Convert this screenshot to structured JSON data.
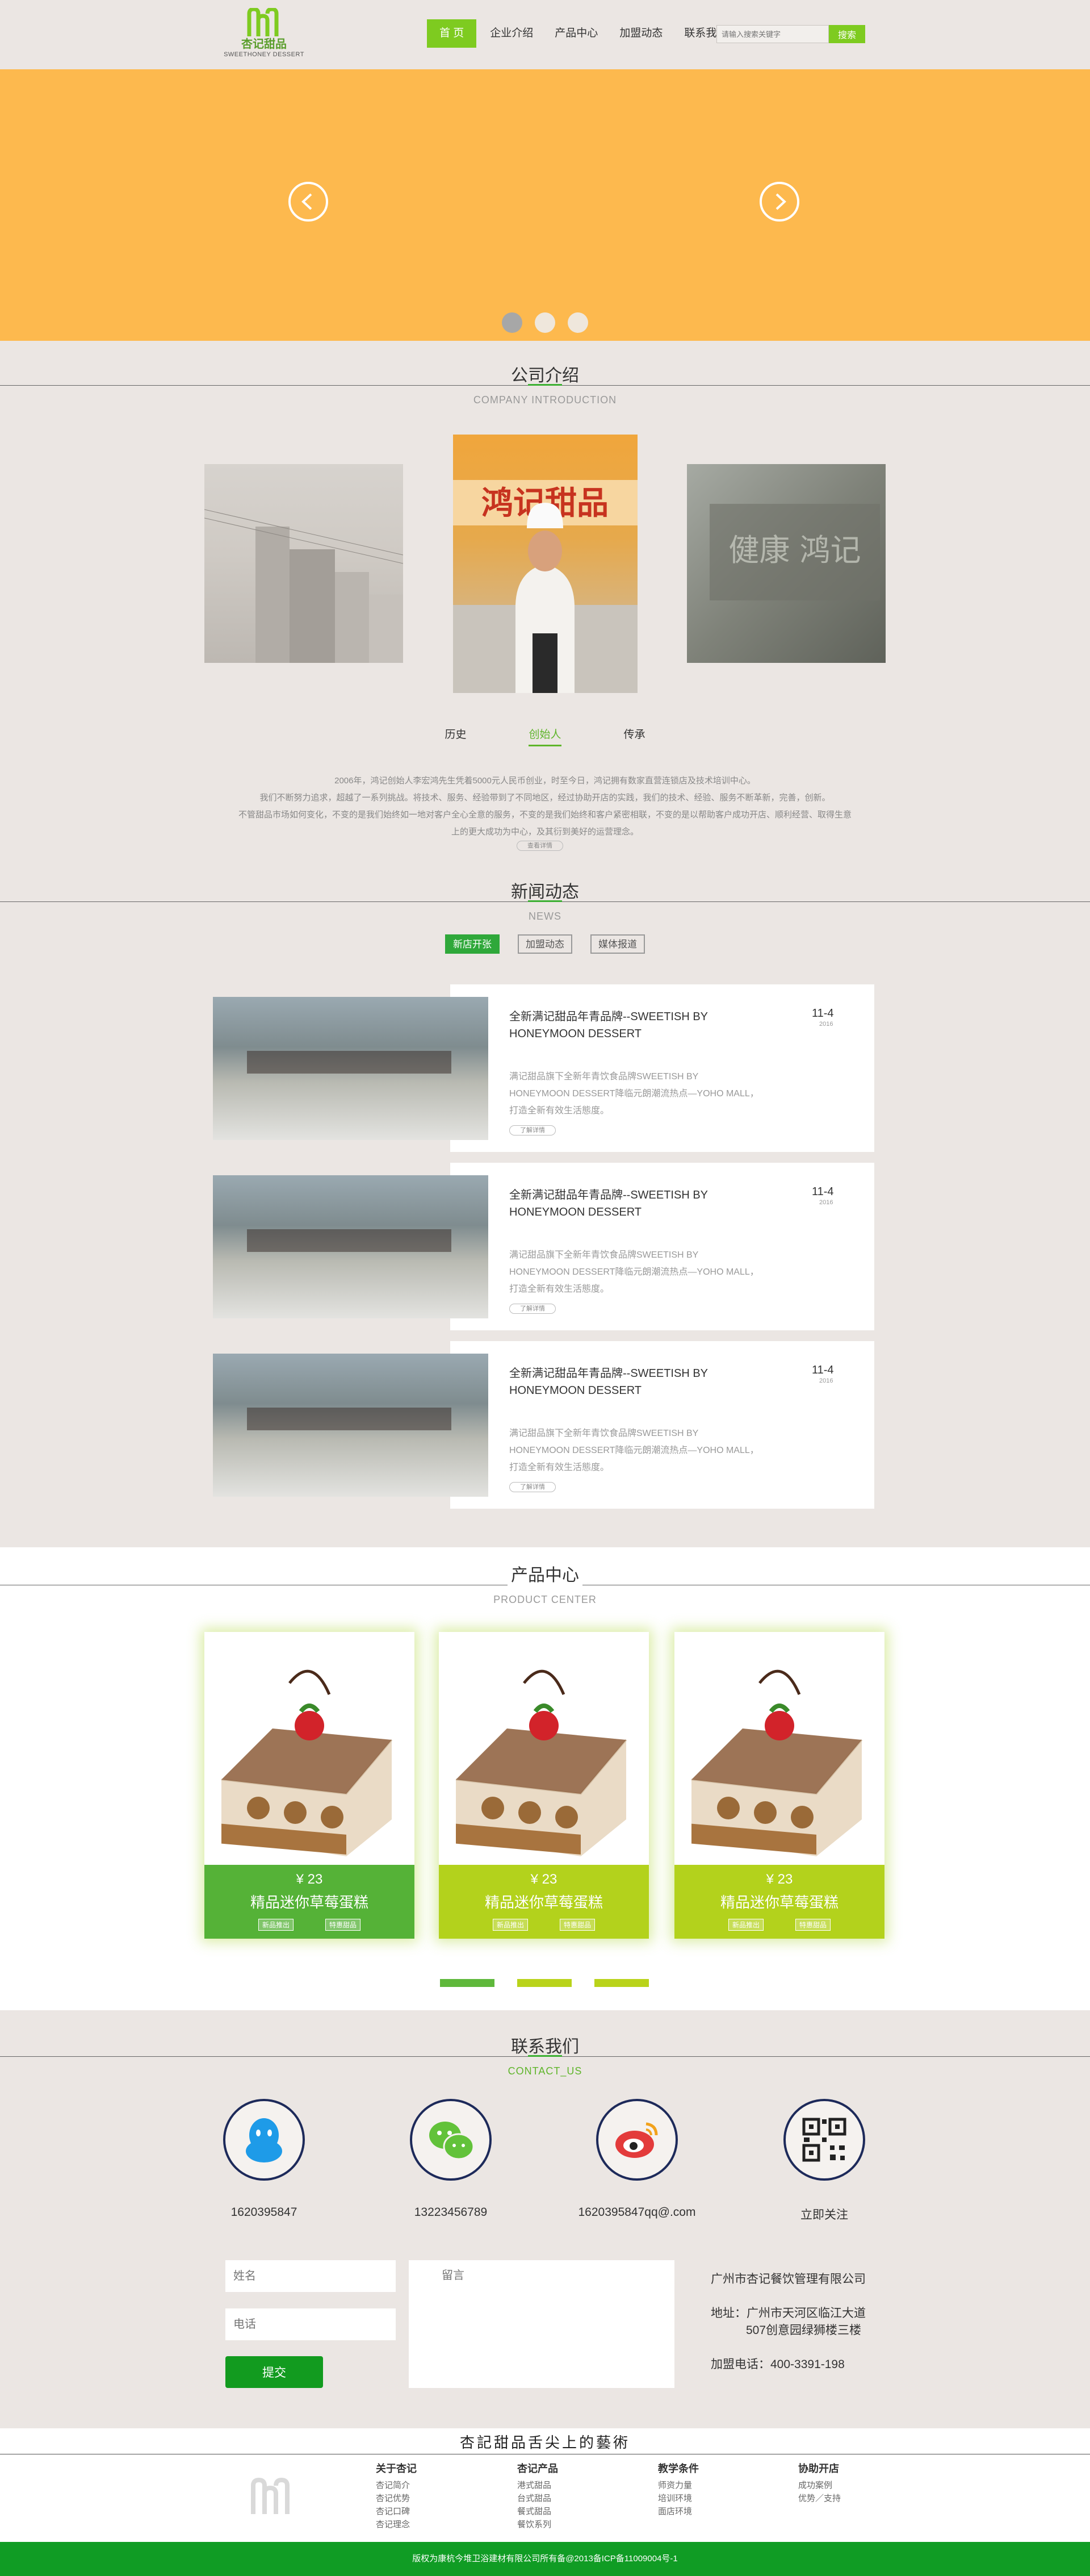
{
  "header": {
    "logo_cn": "杏记甜品",
    "logo_en": "SWEETHONEY DESSERT",
    "nav": [
      "首 页",
      "企业介绍",
      "产品中心",
      "加盟动态",
      "联系我们"
    ],
    "search_placeholder": "请输入搜索关键字",
    "search_button": "搜索"
  },
  "colors": {
    "accent": "#7ecb20",
    "banner": "#fdb94e",
    "news_active": "#2fa83a",
    "footer": "#109c24"
  },
  "about": {
    "title": "公司介绍",
    "subtitle": "COMPANY INTRODUCTION",
    "tabs": [
      "历史",
      "创始人",
      "传承"
    ],
    "active_tab": 1,
    "text": [
      "2006年，鸿记创始人李宏鸿先生凭着5000元人民币创业，时至今日，鸿记拥有数家直营连锁店及技术培训中心。",
      "我们不断努力追求，超越了一系列挑战。将技术、服务、经验带到了不同地区，经过协助开店的实践，我们的技术、经验、服务不断革新，完善，创新。",
      "不管甜品市场如何变化，不变的是我们始终如一地对客户全心全意的服务，不变的是我们始终和客户紧密相联，不变的是以帮助客户成功开店、顺利经营、取得生意",
      "上的更大成功为中心，及其衍到美好的运营理念。"
    ],
    "more": "查看详情"
  },
  "news": {
    "title": "新闻动态",
    "subtitle": "NEWS",
    "tabs": [
      "新店开张",
      "加盟动态",
      "媒体报道"
    ],
    "items": [
      {
        "title": "全新满记甜品年青品牌--SWEETISH BY HONEYMOON DESSERT",
        "date": "11-4",
        "year": "2016",
        "desc": "满记甜品旗下全新年青饮食品牌SWEETISH BY HONEYMOON DESSERT降临元朗潮流热点—YOHO MALL，打造全新有效生活態度。",
        "more": "了解详情"
      },
      {
        "title": "全新满记甜品年青品牌--SWEETISH BY HONEYMOON DESSERT",
        "date": "11-4",
        "year": "2016",
        "desc": "满记甜品旗下全新年青饮食品牌SWEETISH BY HONEYMOON DESSERT降临元朗潮流热点—YOHO MALL，打造全新有效生活態度。",
        "more": "了解详情"
      },
      {
        "title": "全新满记甜品年青品牌--SWEETISH BY HONEYMOON DESSERT",
        "date": "11-4",
        "year": "2016",
        "desc": "满记甜品旗下全新年青饮食品牌SWEETISH BY HONEYMOON DESSERT降临元朗潮流热点—YOHO MALL，打造全新有效生活態度。",
        "more": "了解详情"
      }
    ]
  },
  "products": {
    "title": "产品中心",
    "subtitle": "PRODUCT CENTER",
    "items": [
      {
        "price": "¥ 23",
        "name": "精品迷你草莓蛋糕",
        "tag1": "新品推出",
        "tag2": "特惠甜品",
        "color": "#55b237"
      },
      {
        "price": "¥ 23",
        "name": "精品迷你草莓蛋糕",
        "tag1": "新品推出",
        "tag2": "特惠甜品",
        "color": "#b3d21c"
      },
      {
        "price": "¥ 23",
        "name": "精品迷你草莓蛋糕",
        "tag1": "新品推出",
        "tag2": "特惠甜品",
        "color": "#b3d21c"
      }
    ]
  },
  "contact": {
    "title": "联系我们",
    "subtitle": "CONTACT_US",
    "items": [
      {
        "icon": "qq-icon",
        "text": "1620395847"
      },
      {
        "icon": "wechat-icon",
        "text": "13223456789"
      },
      {
        "icon": "weibo-icon",
        "text": "1620395847qq@.com"
      },
      {
        "icon": "qrcode-icon",
        "text": "立即关注"
      }
    ],
    "name_placeholder": "姓名",
    "phone_placeholder": "电话",
    "message_placeholder": "留言",
    "submit": "提交",
    "company": "广州市杏记餐饮管理有限公司",
    "address1": "地址：广州市天河区临江大道",
    "address2": "507创意园绿狮楼三楼",
    "tel": "加盟电话：400-3391-198"
  },
  "footer": {
    "slogan": "杏記甜品舌尖上的藝術",
    "cols": [
      {
        "h": "关于杏记",
        "links": [
          "杏记简介",
          "杏记优势",
          "杏记口碑",
          "杏记理念"
        ]
      },
      {
        "h": "杏记产品",
        "links": [
          "港式甜品",
          "台式甜品",
          "餐式甜品",
          "餐饮系列"
        ]
      },
      {
        "h": "教学条件",
        "links": [
          "师资力量",
          "培训环境",
          "面店环境"
        ]
      },
      {
        "h": "协助开店",
        "links": [
          "成功案例",
          "优势／支持"
        ]
      }
    ],
    "copyright": "版权为康杭今堆卫浴建材有限公司所有备@2013备ICP备11009004号-1"
  }
}
